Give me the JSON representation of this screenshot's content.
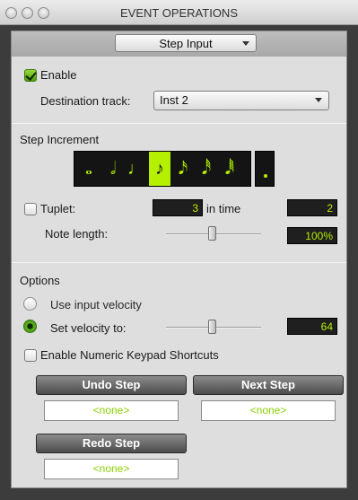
{
  "window": {
    "title": "EVENT OPERATIONS"
  },
  "operation_selector": {
    "value": "Step Input"
  },
  "enable": {
    "label": "Enable",
    "checked": true
  },
  "destination": {
    "label": "Destination track:",
    "value": "Inst 2"
  },
  "step_increment": {
    "title": "Step Increment",
    "notes": [
      {
        "icon": "whole-note-icon",
        "glyph": "𝅝",
        "selected": false
      },
      {
        "icon": "half-note-icon",
        "glyph": "𝅗𝅥",
        "selected": false
      },
      {
        "icon": "quarter-note-icon",
        "glyph": "♩",
        "selected": false
      },
      {
        "icon": "eighth-note-icon",
        "glyph": "♪",
        "selected": true
      },
      {
        "icon": "sixteenth-note-icon",
        "glyph": "𝅘𝅥𝅯",
        "selected": false
      },
      {
        "icon": "thirty-second-note-icon",
        "glyph": "𝅘𝅥𝅰",
        "selected": false
      },
      {
        "icon": "sixty-fourth-note-icon",
        "glyph": "𝅘𝅥𝅱",
        "selected": false
      }
    ],
    "dotted_icon": "dot-icon",
    "tuplet": {
      "label": "Tuplet:",
      "checked": false,
      "value": "3",
      "in_time_label": "in time",
      "in_time_value": "2"
    },
    "note_length": {
      "label": "Note length:",
      "value": "100%",
      "level": 0.5
    }
  },
  "options": {
    "title": "Options",
    "use_input_velocity": {
      "label": "Use input velocity",
      "selected": false
    },
    "set_velocity": {
      "label": "Set velocity to:",
      "selected": true,
      "value": "64",
      "level": 0.5
    },
    "numeric_keypad": {
      "label": "Enable Numeric Keypad Shortcuts",
      "checked": false
    }
  },
  "buttons": {
    "undo": {
      "label": "Undo Step",
      "shortcut": "<none>"
    },
    "next": {
      "label": "Next Step",
      "shortcut": "<none>"
    },
    "redo": {
      "label": "Redo Step",
      "shortcut": "<none>"
    }
  },
  "colors": {
    "accent": "#b4f000",
    "lcd_bg": "#1f1f1f"
  }
}
